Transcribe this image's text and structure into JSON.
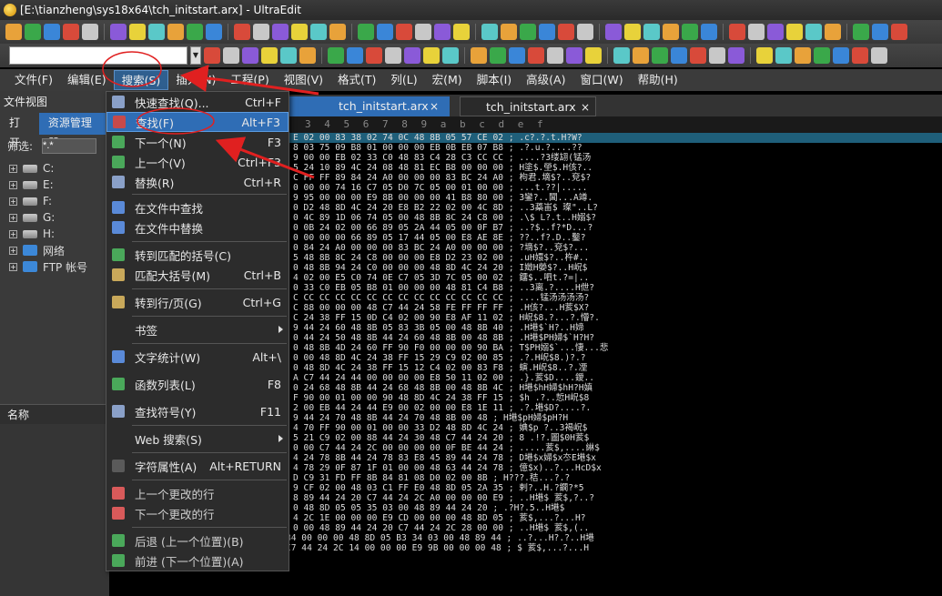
{
  "window": {
    "title": "[E:\\tianzheng\\sys18x64\\tch_initstart.arx] - UltraEdit"
  },
  "menubar": {
    "items": [
      "文件(F)",
      "编辑(E)",
      "搜索(S)",
      "插入(N)",
      "工程(P)",
      "视图(V)",
      "格式(T)",
      "列(L)",
      "宏(M)",
      "脚本(I)",
      "高级(A)",
      "窗口(W)",
      "帮助(H)"
    ]
  },
  "left_panel": {
    "title": "文件视图",
    "tabs": [
      "打开",
      "资源管理器"
    ],
    "filter_label": "筛选:",
    "filter_value": "*.*",
    "tree": [
      "C:",
      "E:",
      "F:",
      "G:",
      "H:",
      "网络",
      "FTP 帐号"
    ],
    "list_header": "名称"
  },
  "editor": {
    "tabs": [
      {
        "label": "tch_initstart.arx",
        "close": "×"
      },
      {
        "label": "tch_initstart.arx",
        "close": "×"
      }
    ],
    "ruler": "3 4 5 6 7 8 9 a b c d e f"
  },
  "hex_lines": [
    "E 02 00 83 38 02 74 0C 48 8B 05 57 CE 02 ; .c?.?.t.H?W?",
    "8 03 75 09 B8 01 00 00 00 EB 0B EB 07 B8 ; .?.u.?....??",
    "9 00 00 EB 02 33 C0 48 83 C4 28 C3 CC CC ; ....?3缕翃(锰汤",
    "5 24 10 89 4C 24 08 48 81 EC B8 00 00 00 ; H塗$.塋$.H侅?..",
    "C FF FF 89 84 24 A0 00 00 00 83 BC 24 A0 ; 枸君.墑$?..兗$?",
    "0 00 00 74 16 C7 05 D0 7C 05 00 01 00 00 ; ...t.??|.....",
    "9 95 00 00 00 E9 8B 00 00 00 41 B8 80 00 ; 3鑾?..閶...A竴.",
    "0 D2 48 8D 4C 24 20 E8 B2 22 02 00 4C 8D ; ..3蘃峀$ 璨\"..L?",
    "0 4C 89 1D 06 74 05 00 48 8B 8C 24 C8 00 ; .\\$ L?.t..H嫋$?",
    "0 0B 24 02 00 66 89 05 2A 44 05 00 0F B7 ; ..?$..f?*D...?",
    "0 00 00 00 66 89 05 17 44 05 00 E8 AE 8E ; ??..f?.D..鑿?",
    "0 84 24 A0 00 00 00 83 BC 24 A0 00 00 00 ; ?墑$?..兗$?...",
    "5 48 8B 8C 24 C8 00 00 00 E8 D2 23 02 00 ; .uH嬛$?..杵#..",
    "0 48 8B 94 24 C0 00 00 00 48 8D 4C 24 20 ; I嬍H嫈$?..H岲$",
    "4 02 00 E5 C0 74 0E C7 05 3D 7C 05 00 02 ; 鐂$..呬t.?=|..",
    "0 33 C0 EB 05 B8 01 00 00 00 48 81 C4 B8 ; ..3离.?....H伳?",
    "C CC CC CC CC CC CC CC CC CC CC CC CC CC ; ....锰汤汤汤汤?",
    "C 88 00 00 00 48 C7 44 24 58 FE FF FF FF ; .H侅?...H荄$X?",
    "C 24 38 FF 15 0D C4 02 00 90 E8 AF 11 02 ; H岲$8.?...?.懵?.",
    "9 44 24 60 48 8B 05 83 3B 05 00 48 8B 40 ; .H塂$`H?..H媂",
    "0 44 24 50 48 8B 44 24 60 48 8B 00 48 8B ; .H塂$PH婦$`H?H?",
    "0 48 8B 4D 24 60 FF 90 F0 00 00 00 90 BA ; T$PH嫋$`...悽...悲",
    "0 00 48 8D 4C 24 38 FF 15 29 C9 02 00 85 ; .?.H岲$8.)?.?",
    "0 48 8D 4C 24 38 FF 15 12 C4 02 00 83 F8 ; 螾.H岲$8..?.凐",
    "A C7 44 24 44 00 00 00 00 E8 50 11 02 00 ; .}.荄$D....鑀..",
    "0 24 68 48 8B 44 24 68 48 8B 00 48 8B 4C ; H塂$hH婦$hH?H嫃",
    "F 90 00 01 00 00 90 48 8D 4C 24 38 FF 15 ; $h .?..悊H岲$8",
    "2 00 EB 44 24 44 E9 00 02 00 00 E8 1E 11 ; .?.塂$D?....?.",
    "9 44 24 70 48 8B 44 24 70 48 8B 00 48 ; H塂$pH婦$pH?H",
    "4 70 FF 90 00 01 00 00 33 D2 48 8D 4C 24 ; 婰$p ?..3褐岲$",
    "5 21 C9 02 00 88 44 24 30 48 C7 44 24 20 ; 8 .!?.圖$0H荄$",
    "0 00 C7 44 24 2C 00 00 00 00 0F BE 44 24 ; .....荄$,....綝$",
    "4 24 78 8B 44 24 78 83 E8 45 89 44 24 78 ; D塂$x婦$x冭E塂$x",
    "4 78 29 0F 87 1F 01 00 00 48 63 44 24 78 ; 億$x)..?...HcD$x",
    "D C9 31 FD FF 8B 84 81 08 D0 02 00 8B ; H???.秸...?.?",
    "9 CF 02 00 48 03 C1 FF E0 48 8D 05 2A 35 ; 剌?..H.?鐗?*5",
    "8 89 44 24 20 C7 44 24 2C A0 00 00 00 E9 ; ..H塂$ 荄$,?..?",
    "0 48 8D 05 05 35 03 00 48 89 44 24 20 ; .?H?.5..H塂$",
    "4 2C 1E 00 00 00 E9 CD 00 00 00 48 8D 05 ; 荄$,...?...H?",
    "0 00 48 89 44 24 20 C7 44 24 2C 28 00 00 ; ..H塂$ 荄$,(..",
    "00002c290h: 00 E9 B4 00 00 00 48 8D 05 B3 34 03 00 48 89 44 ; ..?...H?.?..H塂",
    "00002c2a0h: 24 20 C7 44 24 2C 14 00 00 00 E9 9B 00 00 00 48 ; $ 荄$,...?...H"
  ],
  "search_menu": {
    "items": [
      {
        "label": "快速查找(Q)...",
        "shortcut": "Ctrl+F"
      },
      {
        "label": "查找(F)",
        "shortcut": "Alt+F3"
      },
      {
        "label": "下一个(N)",
        "shortcut": "F3"
      },
      {
        "label": "上一个(V)",
        "shortcut": "Ctrl+F3"
      },
      {
        "label": "替换(R)",
        "shortcut": "Ctrl+R"
      },
      {
        "label": "在文件中查找",
        "shortcut": ""
      },
      {
        "label": "在文件中替换",
        "shortcut": ""
      },
      {
        "label": "转到匹配的括号(C)",
        "shortcut": ""
      },
      {
        "label": "匹配大括号(M)",
        "shortcut": "Ctrl+B"
      },
      {
        "label": "转到行/页(G)",
        "shortcut": "Ctrl+G"
      },
      {
        "label": "书签",
        "shortcut": ""
      },
      {
        "label": "文字统计(W)",
        "shortcut": "Alt+\\"
      },
      {
        "label": "函数列表(L)",
        "shortcut": "F8"
      },
      {
        "label": "查找符号(Y)",
        "shortcut": "F11"
      },
      {
        "label": "Web 搜索(S)",
        "shortcut": ""
      },
      {
        "label": "字符属性(A)",
        "shortcut": "Alt+RETURN"
      },
      {
        "label": "上一个更改的行",
        "shortcut": ""
      },
      {
        "label": "下一个更改的行",
        "shortcut": ""
      },
      {
        "label": "后退 (上一个位置)(B)",
        "shortcut": ""
      },
      {
        "label": "前进 (下一个位置)(A)",
        "shortcut": ""
      }
    ]
  },
  "colors": {
    "accent": "#2f6db5",
    "annotation": "#e02020"
  }
}
